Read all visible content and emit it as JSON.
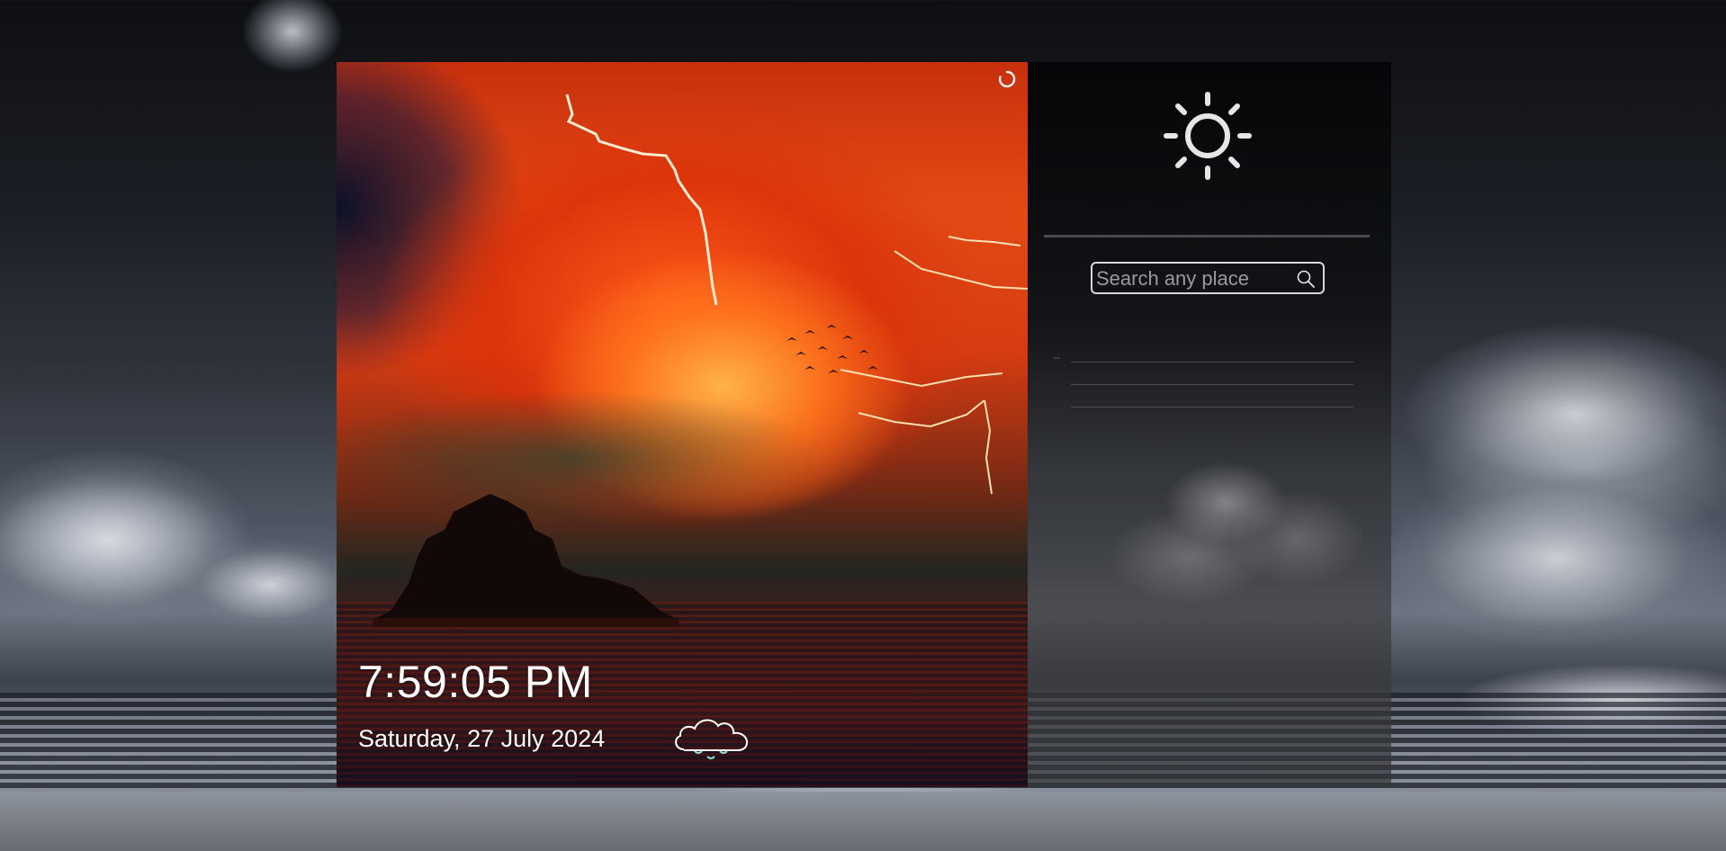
{
  "clock": {
    "time": "7:59:05 PM",
    "date": "Saturday, 27 July 2024"
  },
  "icons": {
    "refresh": "refresh-icon",
    "weather": "cloud-rain-icon",
    "sun": "sun-icon",
    "search": "search-icon"
  },
  "search": {
    "placeholder": "Search any place",
    "value": ""
  },
  "results": [
    "",
    "",
    ""
  ],
  "colors": {
    "panel_dark": "#0a0a0c",
    "sky_red": "#e24a14",
    "text": "#ffffff",
    "search_border": "#d8d8d8"
  }
}
